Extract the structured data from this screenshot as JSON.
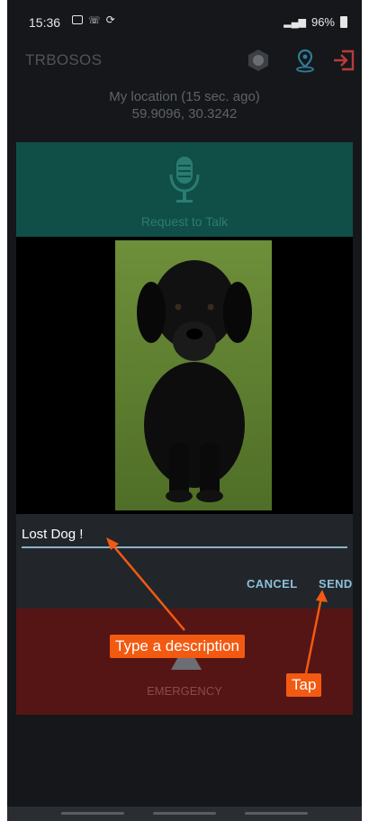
{
  "status_bar": {
    "time": "15:36",
    "battery": "96%"
  },
  "app_bar": {
    "title": "TRBOSOS"
  },
  "location": {
    "label": "My location (15 sec. ago)",
    "coords": "59.9096, 30.3242"
  },
  "talk": {
    "label": "Request to Talk"
  },
  "dialog": {
    "description_value": "Lost Dog !",
    "cancel_label": "CANCEL",
    "send_label": "SEND"
  },
  "emergency": {
    "label": "EMERGENCY"
  },
  "annotations": {
    "type_desc": "Type a description",
    "tap": "Tap"
  },
  "colors": {
    "annotation": "#f25a12",
    "talk_bg": "#0f4f48",
    "emergency_bg": "#561515",
    "accent_blue": "#8cc0dc"
  }
}
